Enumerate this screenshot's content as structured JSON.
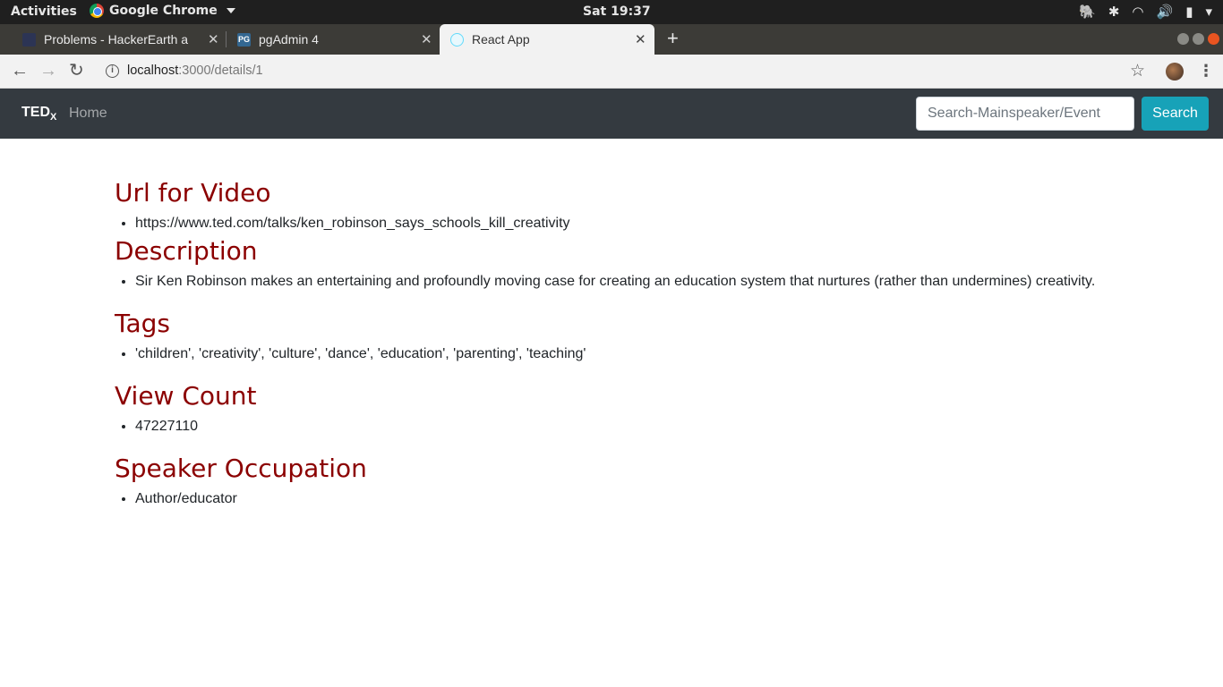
{
  "os": {
    "activities": "Activities",
    "app_name": "Google Chrome",
    "clock": "Sat 19:37"
  },
  "tabs": [
    {
      "label": "Problems - HackerEarth a",
      "favicon_color": "#2c3454"
    },
    {
      "label": "pgAdmin 4",
      "favicon_color": "#336791"
    },
    {
      "label": "React App",
      "favicon_color": "#61dafb"
    }
  ],
  "address": {
    "host": "localhost",
    "path": ":3000/details/1"
  },
  "navbar": {
    "brand": "TED",
    "brand_sub": "X",
    "home": "Home",
    "search_placeholder": "Search-Mainspeaker/Event",
    "search_button": "Search"
  },
  "sections": [
    {
      "heading": "Url for Video",
      "value": "https://www.ted.com/talks/ken_robinson_says_schools_kill_creativity"
    },
    {
      "heading": "Description",
      "value": "Sir Ken Robinson makes an entertaining and profoundly moving case for creating an education system that nurtures (rather than undermines) creativity."
    },
    {
      "heading": "Tags",
      "value": "'children', 'creativity', 'culture', 'dance', 'education', 'parenting', 'teaching'"
    },
    {
      "heading": "View Count",
      "value": "47227110"
    },
    {
      "heading": "Speaker Occupation",
      "value": "Author/educator"
    }
  ],
  "colors": {
    "heading": "#8b0000",
    "navbar_bg": "#343a40",
    "search_button": "#17a2b8"
  }
}
